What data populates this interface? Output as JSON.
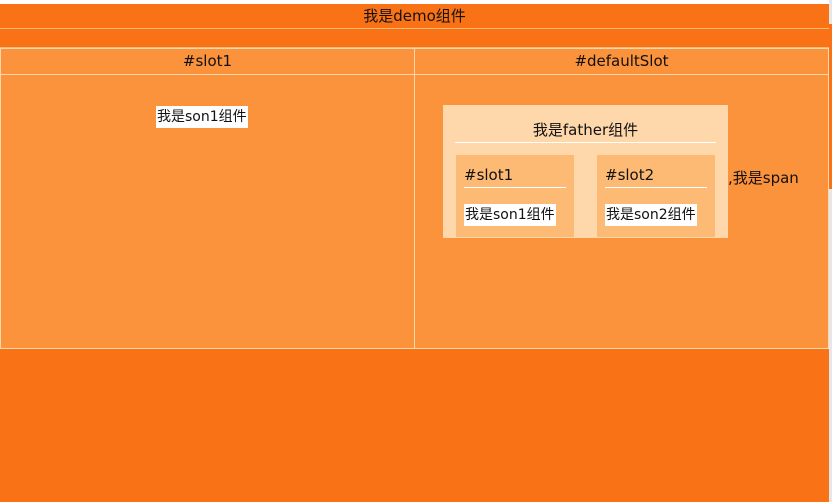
{
  "demo": {
    "title": "我是demo组件"
  },
  "columns": [
    {
      "header": "#slot1"
    },
    {
      "header": "#defaultSlot"
    }
  ],
  "slot1_panel": {
    "son": "我是son1组件"
  },
  "default_panel": {
    "father": {
      "title": "我是father组件",
      "slots": [
        {
          "title": "#slot1",
          "son": "我是son1组件"
        },
        {
          "title": "#slot2",
          "son": "我是son2组件"
        }
      ]
    },
    "span_text": ",我是span"
  },
  "colors": {
    "demo_bg": "#f97316",
    "panel_bg": "#fb923c",
    "father_bg": "#fed7aa",
    "slot_card_bg": "#fdba74",
    "son_bg": "#ffffff"
  }
}
